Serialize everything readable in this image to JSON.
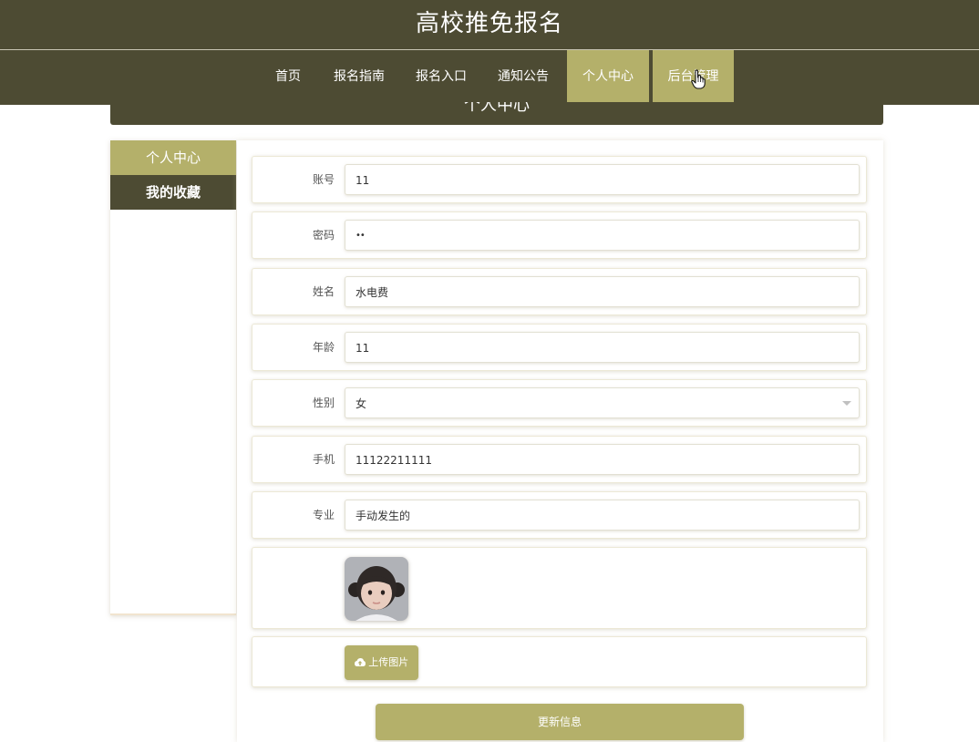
{
  "site": {
    "title": "高校推免报名"
  },
  "nav": {
    "items": [
      "首页",
      "报名指南",
      "报名入口",
      "通知公告",
      "个人中心",
      "后台管理"
    ],
    "active_item": "个人中心"
  },
  "banner": {
    "title": "个人中心"
  },
  "sidebar": {
    "items": [
      "个人中心",
      "我的收藏"
    ],
    "active_item": "个人中心"
  },
  "form": {
    "fields": [
      {
        "label": "账号",
        "value": "11"
      },
      {
        "label": "密码",
        "value": "••"
      },
      {
        "label": "姓名",
        "value": "水电费"
      },
      {
        "label": "年龄",
        "value": "11"
      },
      {
        "label": "性别",
        "value": "女"
      },
      {
        "label": "手机",
        "value": "11122211111"
      },
      {
        "label": "专业",
        "value": "手动发生的"
      }
    ],
    "upload_label": "上传图片",
    "submit_label": "更新信息"
  },
  "icons": {
    "upload": "cloud-upload-icon",
    "select": "chevron-down-icon",
    "cursor": "hand-pointer-icon"
  },
  "colors": {
    "header": "#4d4b33",
    "accent": "#b4b06a"
  }
}
